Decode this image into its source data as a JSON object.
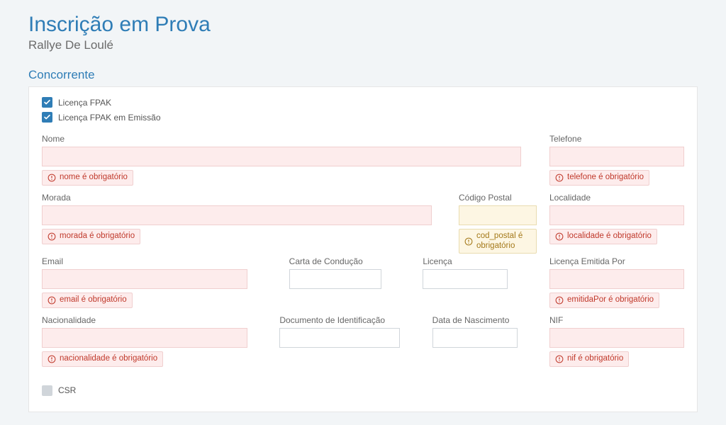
{
  "header": {
    "title": "Inscrição em Prova",
    "subtitle": "Rallye De Loulé"
  },
  "section": {
    "title": "Concorrente"
  },
  "checkboxes": {
    "licenca_fpak": {
      "label": "Licença FPAK",
      "checked": true
    },
    "licenca_fpak_emissao": {
      "label": "Licença FPAK em Emissão",
      "checked": true
    },
    "csr": {
      "label": "CSR",
      "checked": false
    }
  },
  "fields": {
    "nome": {
      "label": "Nome",
      "value": "",
      "error": "nome é obrigatório"
    },
    "telefone": {
      "label": "Telefone",
      "value": "",
      "error": "telefone é obrigatório"
    },
    "morada": {
      "label": "Morada",
      "value": "",
      "error": "morada é obrigatório"
    },
    "cod_postal": {
      "label": "Código Postal",
      "value": "",
      "warn": "cod_postal é obrigatório"
    },
    "localidade": {
      "label": "Localidade",
      "value": "",
      "error": "localidade é obrigatório"
    },
    "email": {
      "label": "Email",
      "value": "",
      "error": "email é obrigatório"
    },
    "carta": {
      "label": "Carta de Condução",
      "value": ""
    },
    "licenca": {
      "label": "Licença",
      "value": ""
    },
    "emitida_por": {
      "label": "Licença Emitida Por",
      "value": "",
      "error": "emitidaPor é obrigatório"
    },
    "nacionalidade": {
      "label": "Nacionalidade",
      "value": "",
      "error": "nacionalidade é obrigatório"
    },
    "doc_id": {
      "label": "Documento de Identificação",
      "value": ""
    },
    "data_nasc": {
      "label": "Data de Nascimento",
      "value": ""
    },
    "nif": {
      "label": "NIF",
      "value": "",
      "error": "nif é obrigatório"
    }
  }
}
